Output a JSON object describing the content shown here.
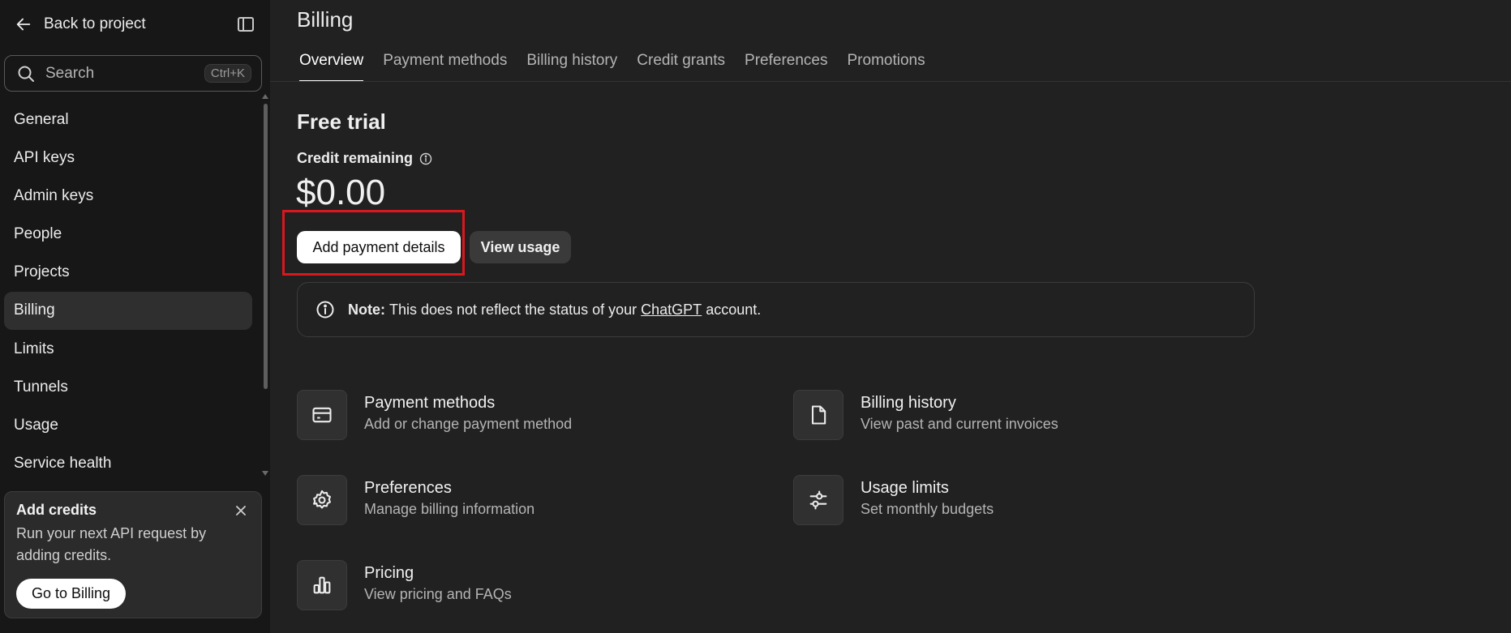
{
  "sidebar": {
    "back_label": "Back to project",
    "search": {
      "label": "Search",
      "shortcut": "Ctrl+K"
    },
    "items": [
      {
        "label": "General"
      },
      {
        "label": "API keys"
      },
      {
        "label": "Admin keys"
      },
      {
        "label": "People"
      },
      {
        "label": "Projects"
      },
      {
        "label": "Billing",
        "active": true
      },
      {
        "label": "Limits"
      },
      {
        "label": "Tunnels"
      },
      {
        "label": "Usage"
      },
      {
        "label": "Service health"
      }
    ],
    "credits_card": {
      "title": "Add credits",
      "body": "Run your next API request by adding credits.",
      "button": "Go to Billing"
    }
  },
  "main": {
    "title": "Billing",
    "tabs": [
      {
        "label": "Overview",
        "active": true
      },
      {
        "label": "Payment methods"
      },
      {
        "label": "Billing history"
      },
      {
        "label": "Credit grants"
      },
      {
        "label": "Preferences"
      },
      {
        "label": "Promotions"
      }
    ],
    "section_title": "Free trial",
    "credit_label": "Credit remaining",
    "credit_amount": "$0.00",
    "buttons": {
      "add_payment": "Add payment details",
      "view_usage": "View usage"
    },
    "note": {
      "prefix": "Note:",
      "text_before": "This does not reflect the status of your",
      "link": "ChatGPT",
      "text_after": "account."
    },
    "cards": [
      {
        "icon": "credit-card-icon",
        "title": "Payment methods",
        "subtitle": "Add or change payment method"
      },
      {
        "icon": "document-icon",
        "title": "Billing history",
        "subtitle": "View past and current invoices"
      },
      {
        "icon": "gear-icon",
        "title": "Preferences",
        "subtitle": "Manage billing information"
      },
      {
        "icon": "sliders-icon",
        "title": "Usage limits",
        "subtitle": "Set monthly budgets"
      },
      {
        "icon": "bar-chart-icon",
        "title": "Pricing",
        "subtitle": "View pricing and FAQs"
      }
    ]
  },
  "colors": {
    "sidebar_bg": "#171717",
    "main_bg": "#212121",
    "highlight": "#d9181e"
  }
}
